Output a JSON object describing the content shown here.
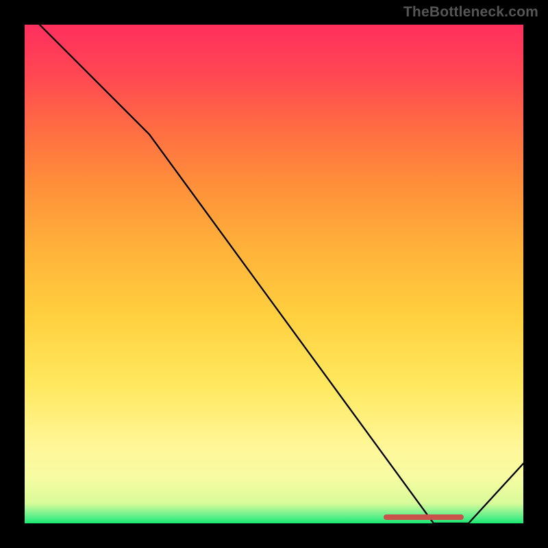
{
  "watermark": "TheBottleneck.com",
  "chart_data": {
    "type": "line",
    "title": "",
    "xlabel": "",
    "ylabel": "",
    "xlim": [
      0,
      100
    ],
    "ylim": [
      0,
      100
    ],
    "series": [
      {
        "name": "curve",
        "points": [
          {
            "x": 3,
            "y": 100
          },
          {
            "x": 25,
            "y": 78
          },
          {
            "x": 82,
            "y": 0
          },
          {
            "x": 89,
            "y": 0
          },
          {
            "x": 100,
            "y": 12
          }
        ]
      }
    ],
    "marker": {
      "x_start": 72,
      "x_end": 88,
      "y": 1
    },
    "gradient_stops": [
      {
        "pos": 0,
        "color": "#17e86f"
      },
      {
        "pos": 4,
        "color": "#d9fb9a"
      },
      {
        "pos": 15,
        "color": "#fff79a"
      },
      {
        "pos": 42,
        "color": "#ffcf3e"
      },
      {
        "pos": 68,
        "color": "#ff8f3a"
      },
      {
        "pos": 90,
        "color": "#ff4753"
      },
      {
        "pos": 100,
        "color": "#ff2f5e"
      }
    ]
  }
}
